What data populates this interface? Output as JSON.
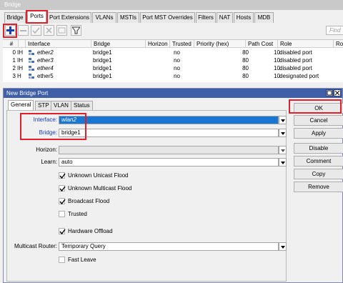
{
  "bridge_window": {
    "title": "Bridge"
  },
  "tabs": [
    "Bridge",
    "Ports",
    "Port Extensions",
    "VLANs",
    "MSTIs",
    "Port MST Overrides",
    "Filters",
    "NAT",
    "Hosts",
    "MDB"
  ],
  "active_tab": "Ports",
  "toolbar": {
    "buttons": [
      "add-icon",
      "remove-icon",
      "enable-icon",
      "disable-icon",
      "comment-icon",
      "filter-icon"
    ],
    "find_placeholder": "Find"
  },
  "ports_table": {
    "columns": [
      "#",
      "",
      "Interface",
      "Bridge",
      "Horizon",
      "Trusted",
      "Priority (hex)",
      "Path Cost",
      "Role",
      "Ro"
    ],
    "rows": [
      {
        "num": "0",
        "flags": "IH",
        "interface": "ether2",
        "bridge": "bridge1",
        "horizon": "",
        "trusted": "no",
        "priority": "80",
        "path_cost": "10",
        "role": "disabled port"
      },
      {
        "num": "1",
        "flags": "IH",
        "interface": "ether3",
        "bridge": "bridge1",
        "horizon": "",
        "trusted": "no",
        "priority": "80",
        "path_cost": "10",
        "role": "disabled port"
      },
      {
        "num": "2",
        "flags": "IH",
        "interface": "ether4",
        "bridge": "bridge1",
        "horizon": "",
        "trusted": "no",
        "priority": "80",
        "path_cost": "10",
        "role": "disabled port"
      },
      {
        "num": "3",
        "flags": "H",
        "interface": "ether5",
        "bridge": "bridge1",
        "horizon": "",
        "trusted": "no",
        "priority": "80",
        "path_cost": "10",
        "role": "designated port"
      }
    ]
  },
  "dialog": {
    "title": "New Bridge Port",
    "tabs": [
      "General",
      "STP",
      "VLAN",
      "Status"
    ],
    "active_tab": "General",
    "fields": {
      "interface_label": "Interface:",
      "interface_value": "wlan2",
      "bridge_label": "Bridge:",
      "bridge_value": "bridge1",
      "horizon_label": "Horizon:",
      "horizon_value": "",
      "learn_label": "Learn:",
      "learn_value": "auto",
      "multicast_router_label": "Multicast Router:",
      "multicast_router_value": "Temporary Query"
    },
    "checkboxes": [
      {
        "label": "Unknown Unicast Flood",
        "checked": true
      },
      {
        "label": "Unknown Multicast Flood",
        "checked": true
      },
      {
        "label": "Broadcast Flood",
        "checked": true
      },
      {
        "label": "Trusted",
        "checked": false
      },
      {
        "label": "Hardware Offload",
        "checked": true
      },
      {
        "label": "Fast Leave",
        "checked": false
      }
    ],
    "buttons": [
      "OK",
      "Cancel",
      "Apply",
      "Disable",
      "Comment",
      "Copy",
      "Remove"
    ]
  },
  "colors": {
    "titlebar": "#3f5fa8",
    "selection": "#1877d3",
    "highlight_box": "#e21f2b",
    "label_blue": "#1a3bb8"
  }
}
